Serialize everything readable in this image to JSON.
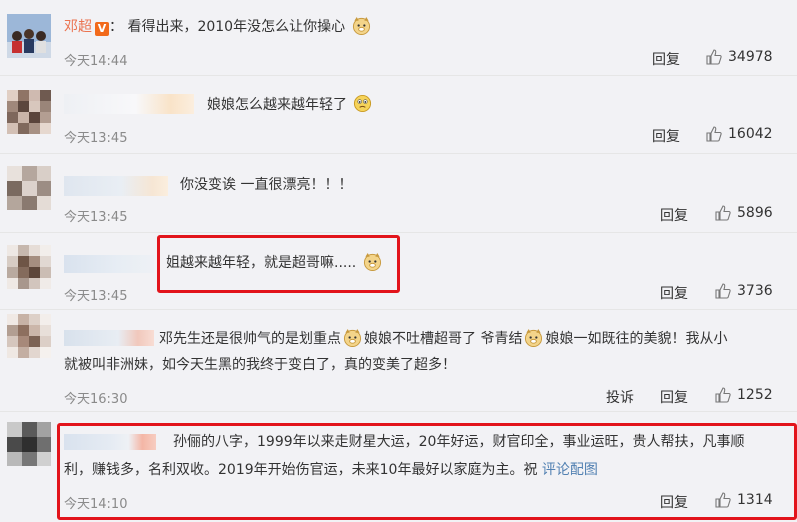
{
  "comments": [
    {
      "user": "邓超",
      "verified_badge": "V",
      "separator": "：",
      "text": "看得出来，2010年没怎么让你操心",
      "emoji": "doge-emoji",
      "time": "今天14:44",
      "reply": "回复",
      "likes": "34978"
    },
    {
      "text": "娘娘怎么越来越年轻了",
      "emoji": "cry-emoji",
      "time": "今天13:45",
      "reply": "回复",
      "likes": "16042"
    },
    {
      "text": "你没变诶 一直很漂亮！！！",
      "time": "今天13:45",
      "reply": "回复",
      "likes": "5896"
    },
    {
      "text": "姐越来越年轻，就是超哥嘛.....",
      "emoji": "doge-emoji",
      "time": "今天13:45",
      "reply": "回复",
      "likes": "3736"
    },
    {
      "text_part1": "邓先生还是很帅气的是划重点",
      "text_part2": "娘娘不吐槽超哥了 爷青结",
      "text_part3": "娘娘一如既往的美貌！我从小",
      "text_line2": "就被叫非洲妹，如今天生黑的我终于变白了，真的变美了超多！",
      "time": "今天16:30",
      "report": "投诉",
      "reply": "回复",
      "likes": "1252"
    },
    {
      "text_line1": "孙俪的八字，1999年以来走财星大运，20年好运，财官印全，事业运旺，贵人帮扶，凡事顺",
      "text_line2": "利，赚钱多，名利双收。2019年开始伤官运，未来10年最好以家庭为主。祝",
      "link": "评论配图",
      "time": "今天14:10",
      "reply": "回复",
      "likes": "1314"
    }
  ],
  "colors": {
    "background": "#f2f2f5",
    "username": "#eb7350",
    "highlight_box": "#e2141b",
    "link": "#5281b2"
  }
}
